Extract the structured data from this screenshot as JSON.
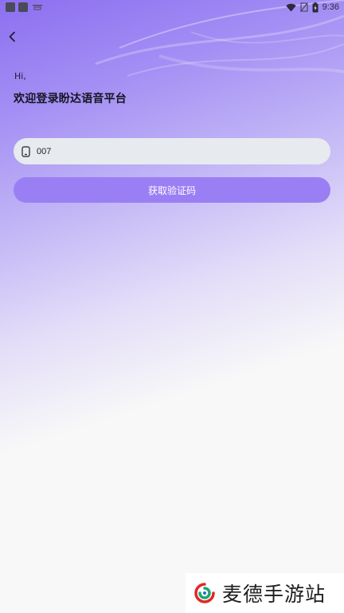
{
  "status_bar": {
    "time": "9:36",
    "icons": [
      "app-icon",
      "app-icon",
      "tray-icon",
      "wifi-icon",
      "no-sim-icon",
      "battery-icon"
    ]
  },
  "nav": {
    "back_icon": "chevron-left-icon"
  },
  "greeting": {
    "hi": "Hi,",
    "title": "欢迎登录盼达语音平台"
  },
  "login": {
    "phone_icon": "phone-icon",
    "phone_value": "007",
    "get_code_label": "获取验证码"
  },
  "watermark": {
    "text": "麦德手游站"
  },
  "colors": {
    "accent": "#9a7ff4",
    "gradient_top": "#8c6ff0",
    "background": "#f8f8f8",
    "input_bg": "#e7eaee"
  }
}
